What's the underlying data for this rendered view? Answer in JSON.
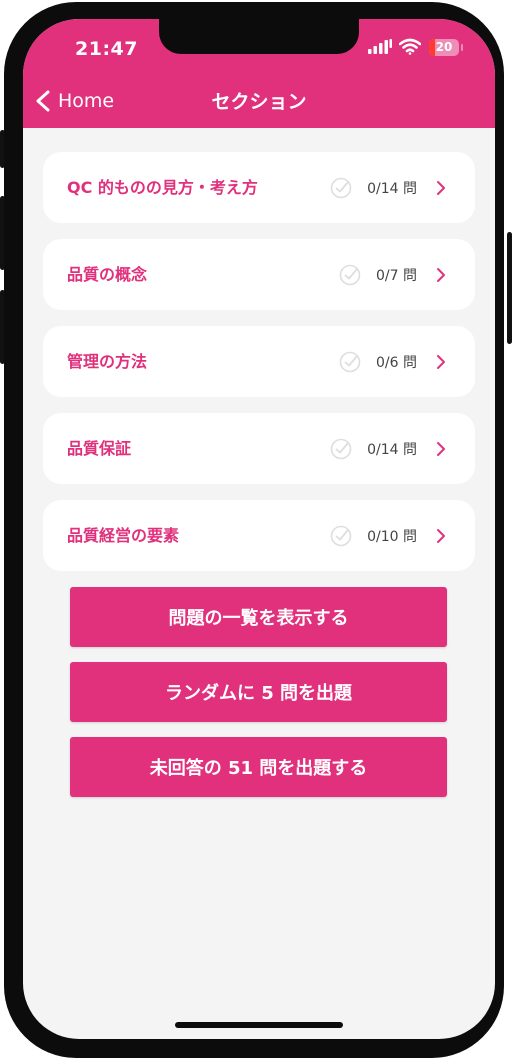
{
  "status_bar": {
    "time": "21:47",
    "battery_level": "20"
  },
  "nav": {
    "back_label": "Home",
    "title": "セクション"
  },
  "sections": [
    {
      "name": "QC 的ものの見方・考え方",
      "count": "0/14 問"
    },
    {
      "name": "品質の概念",
      "count": "0/7 問"
    },
    {
      "name": "管理の方法",
      "count": "0/6 問"
    },
    {
      "name": "品質保証",
      "count": "0/14 問"
    },
    {
      "name": "品質経営の要素",
      "count": "0/10 問"
    }
  ],
  "actions": {
    "list_all": "問題の一覧を表示する",
    "random": "ランダムに 5 問を出題",
    "unanswered": "未回答の 51 問を出題する"
  },
  "colors": {
    "accent": "#e1307c",
    "background": "#f4f4f4",
    "card": "#ffffff",
    "battery_low": "#ff3b30"
  }
}
